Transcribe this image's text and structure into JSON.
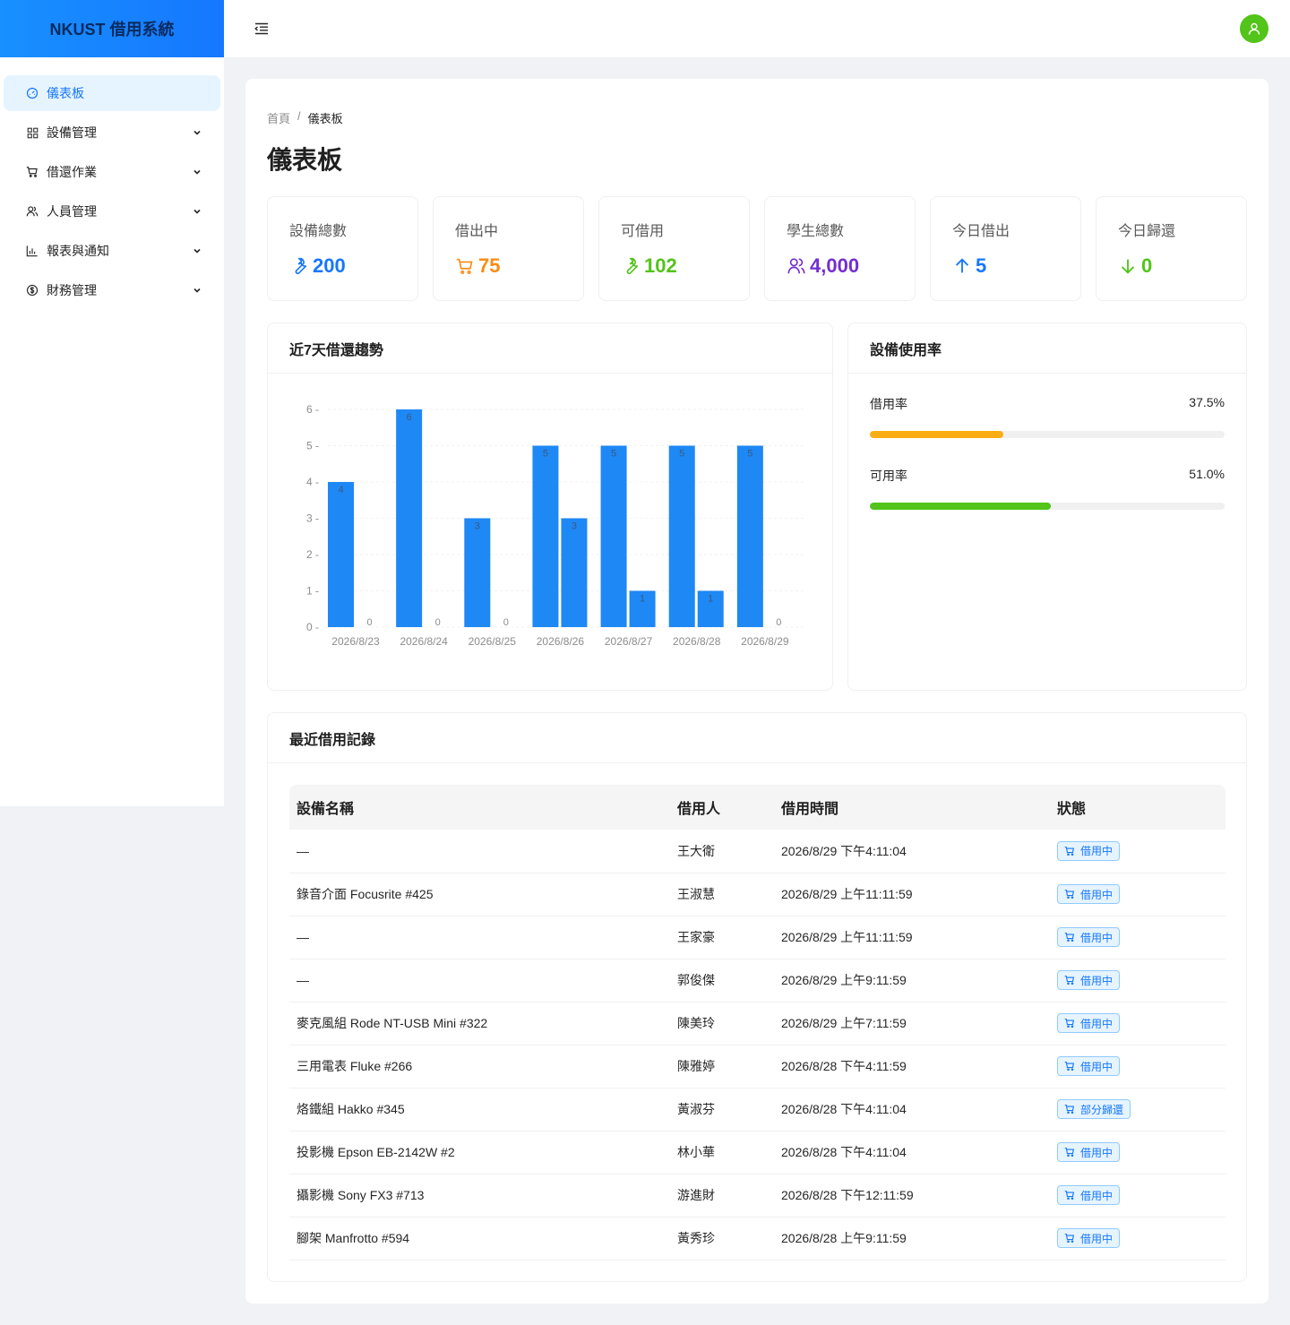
{
  "app": {
    "title": "NKUST 借用系統"
  },
  "sidebar": {
    "items": [
      {
        "label": "儀表板",
        "icon": "dashboard-icon",
        "active": true
      },
      {
        "label": "設備管理",
        "icon": "appstore-icon"
      },
      {
        "label": "借還作業",
        "icon": "shopping-cart-icon"
      },
      {
        "label": "人員管理",
        "icon": "team-icon"
      },
      {
        "label": "報表與通知",
        "icon": "bar-chart-icon"
      },
      {
        "label": "財務管理",
        "icon": "dollar-icon"
      }
    ]
  },
  "breadcrumb": {
    "home": "首頁",
    "separator": "/",
    "current": "儀表板"
  },
  "page_title": "儀表板",
  "stats": [
    {
      "title": "設備總數",
      "value": "200",
      "icon": "tool-icon",
      "color": "#1677ff"
    },
    {
      "title": "借出中",
      "value": "75",
      "icon": "shopping-cart-icon",
      "color": "#fa8c16"
    },
    {
      "title": "可借用",
      "value": "102",
      "icon": "tool-icon",
      "color": "#52c41a"
    },
    {
      "title": "學生總數",
      "value": "4,000",
      "icon": "team-icon",
      "color": "#722ed1"
    },
    {
      "title": "今日借出",
      "value": "5",
      "icon": "arrow-up-icon",
      "color": "#1677ff"
    },
    {
      "title": "今日歸還",
      "value": "0",
      "icon": "arrow-down-icon",
      "color": "#52c41a"
    }
  ],
  "trend_card": {
    "title": "近7天借還趨勢"
  },
  "usage_card": {
    "title": "設備使用率",
    "rows": [
      {
        "label": "借用率",
        "value_text": "37.5%",
        "percent": 37.5,
        "color": "#faad14"
      },
      {
        "label": "可用率",
        "value_text": "51.0%",
        "percent": 51.0,
        "color": "#52c41a"
      }
    ]
  },
  "chart_data": {
    "type": "bar",
    "categories": [
      "2026/8/23",
      "2026/8/24",
      "2026/8/25",
      "2026/8/26",
      "2026/8/27",
      "2026/8/28",
      "2026/8/29"
    ],
    "series": [
      {
        "values": [
          4,
          6,
          3,
          5,
          5,
          5,
          5
        ],
        "color": "#1e88f5"
      },
      {
        "values": [
          0,
          0,
          0,
          3,
          1,
          1,
          0
        ],
        "color": "#1e88f5"
      }
    ],
    "ylim": [
      0,
      6
    ],
    "yticks": [
      0,
      1,
      2,
      3,
      4,
      5,
      6
    ],
    "grid": true,
    "data_labels": true
  },
  "records": {
    "title": "最近借用記錄",
    "columns": [
      "設備名稱",
      "借用人",
      "借用時間",
      "狀態"
    ],
    "rows": [
      {
        "name": "—",
        "borrower": "王大衛",
        "time": "2026/8/29 下午4:11:04",
        "status": "借用中"
      },
      {
        "name": "錄音介面 Focusrite #425",
        "borrower": "王淑慧",
        "time": "2026/8/29 上午11:11:59",
        "status": "借用中"
      },
      {
        "name": "—",
        "borrower": "王家豪",
        "time": "2026/8/29 上午11:11:59",
        "status": "借用中"
      },
      {
        "name": "—",
        "borrower": "郭俊傑",
        "time": "2026/8/29 上午9:11:59",
        "status": "借用中"
      },
      {
        "name": "麥克風組 Rode NT-USB Mini #322",
        "borrower": "陳美玲",
        "time": "2026/8/29 上午7:11:59",
        "status": "借用中"
      },
      {
        "name": "三用電表 Fluke #266",
        "borrower": "陳雅婷",
        "time": "2026/8/28 下午4:11:59",
        "status": "借用中"
      },
      {
        "name": "烙鐵組 Hakko #345",
        "borrower": "黃淑芬",
        "time": "2026/8/28 下午4:11:04",
        "status": "部分歸還"
      },
      {
        "name": "投影機 Epson EB-2142W #2",
        "borrower": "林小華",
        "time": "2026/8/28 下午4:11:04",
        "status": "借用中"
      },
      {
        "name": "攝影機 Sony FX3 #713",
        "borrower": "游進財",
        "time": "2026/8/28 下午12:11:59",
        "status": "借用中"
      },
      {
        "name": "腳架 Manfrotto #594",
        "borrower": "黃秀珍",
        "time": "2026/8/28 上午9:11:59",
        "status": "借用中"
      }
    ]
  }
}
